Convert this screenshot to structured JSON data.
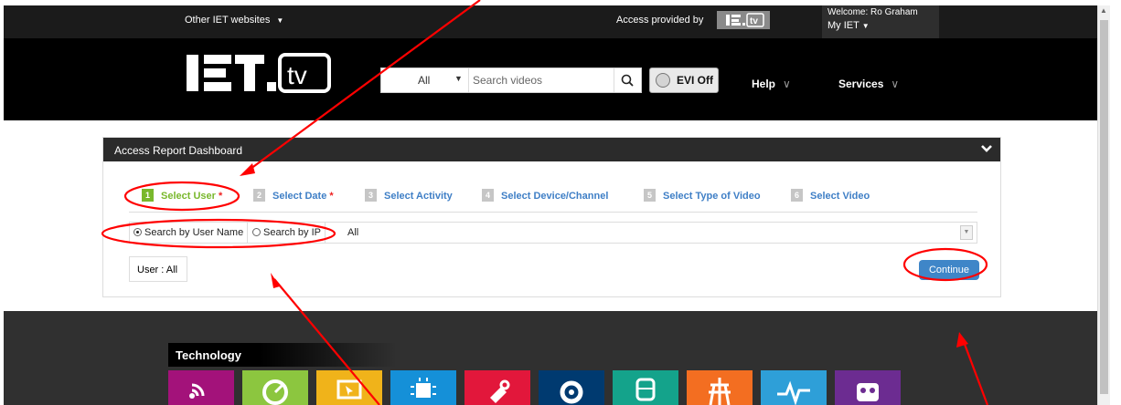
{
  "topbar": {
    "other_sites": "Other IET websites",
    "access_provided": "Access provided by",
    "access_logo": "IET.tv",
    "welcome": "Welcome: Ro Graham",
    "my_iet": "My IET"
  },
  "header": {
    "logo": "IET.tv",
    "search_scope": "All",
    "search_placeholder": "Search videos",
    "evi": "EVI Off",
    "help": "Help",
    "services": "Services"
  },
  "dashboard": {
    "title": "Access Report Dashboard",
    "steps": [
      {
        "num": "1",
        "label": "Select User",
        "required": true
      },
      {
        "num": "2",
        "label": "Select Date",
        "required": true
      },
      {
        "num": "3",
        "label": "Select Activity",
        "required": false
      },
      {
        "num": "4",
        "label": "Select Device/Channel",
        "required": false
      },
      {
        "num": "5",
        "label": "Select Type of Video",
        "required": false
      },
      {
        "num": "6",
        "label": "Select Video",
        "required": false
      }
    ],
    "required_mark": "*",
    "radio_user": "Search by User Name",
    "radio_ip": "Search by IP",
    "filter_value": "All",
    "user_label": "User : All",
    "continue": "Continue"
  },
  "footer": {
    "technology": "Technology",
    "tiles": [
      {
        "icon": "broadcast-icon",
        "color": "#a3127a"
      },
      {
        "icon": "gauge-icon",
        "color": "#8cc63f"
      },
      {
        "icon": "monitor-cursor-icon",
        "color": "#f0b31a"
      },
      {
        "icon": "chip-icon",
        "color": "#1590d8"
      },
      {
        "icon": "tools-icon",
        "color": "#e2173b"
      },
      {
        "icon": "gear-icon",
        "color": "#003a70"
      },
      {
        "icon": "train-icon",
        "color": "#14a38b"
      },
      {
        "icon": "pylon-icon",
        "color": "#f36e21"
      },
      {
        "icon": "pulse-icon",
        "color": "#2e9fd8"
      },
      {
        "icon": "owl-icon",
        "color": "#6c2c91"
      }
    ]
  },
  "colors": {
    "active_step": "#79b82c",
    "link": "#3f7fc6",
    "button": "#3f86c8",
    "annotation": "#ff0000"
  }
}
